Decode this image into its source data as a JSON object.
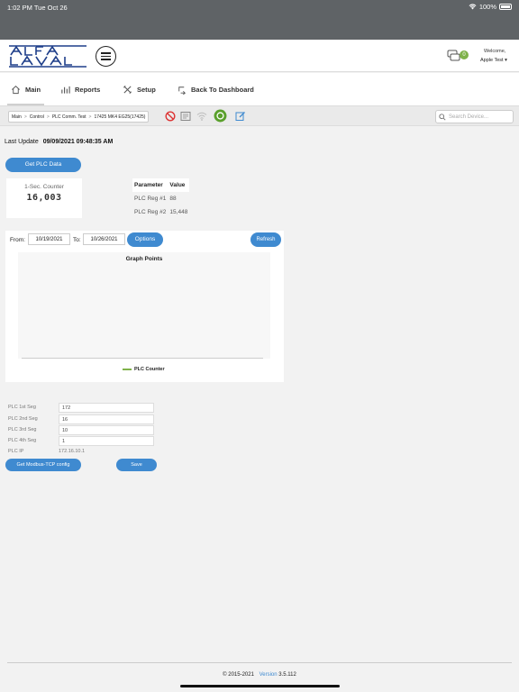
{
  "status_bar": {
    "time": "1:02 PM  Tue Oct 26",
    "battery": "100%"
  },
  "header": {
    "welcome": "Welcome,",
    "user": "Apple Test",
    "notification_count": "0"
  },
  "nav": {
    "tabs": [
      "Main",
      "Reports",
      "Setup",
      "Back To Dashboard"
    ],
    "active": "Main"
  },
  "breadcrumb": [
    "Main",
    "Control",
    "PLC Comm. Test",
    "17425 MK4 EG25(17425)"
  ],
  "search": {
    "placeholder": "Search Device..."
  },
  "last_update": {
    "label": "Last Update",
    "value": "09/09/2021 09:48:35 AM"
  },
  "get_plc_button": "Get PLC Data",
  "counter": {
    "label": "1-Sec. Counter",
    "value": "16,003"
  },
  "registers": {
    "headers": [
      "Parameter",
      "Value"
    ],
    "rows": [
      {
        "param": "PLC Reg #1",
        "value": "88"
      },
      {
        "param": "PLC Reg #2",
        "value": "15,448"
      }
    ]
  },
  "graph": {
    "from_label": "From:",
    "from_value": "10/19/2021",
    "to_label": "To:",
    "to_value": "10/26/2021",
    "options_label": "Options",
    "refresh_label": "Refresh",
    "title": "Graph Points",
    "legend": "PLC Counter",
    "legend_color": "#7fb24a"
  },
  "plc_config": {
    "rows": [
      {
        "label": "PLC 1st Seg",
        "value": "172"
      },
      {
        "label": "PLC 2nd Seg",
        "value": "16"
      },
      {
        "label": "PLC 3rd Seg",
        "value": "10"
      },
      {
        "label": "PLC 4th Seg",
        "value": "1"
      }
    ],
    "ip_label": "PLC IP",
    "ip_value": "172.16.10.1",
    "modbus_button": "Get Modbus-TCP config",
    "save_button": "Save"
  },
  "footer": {
    "copyright": "© 2015-2021",
    "version_label": "Version",
    "version": "3.5.112"
  },
  "colors": {
    "accent": "#3f8ad0",
    "statusbar": "#5f6366",
    "badge": "#7fb24a"
  }
}
